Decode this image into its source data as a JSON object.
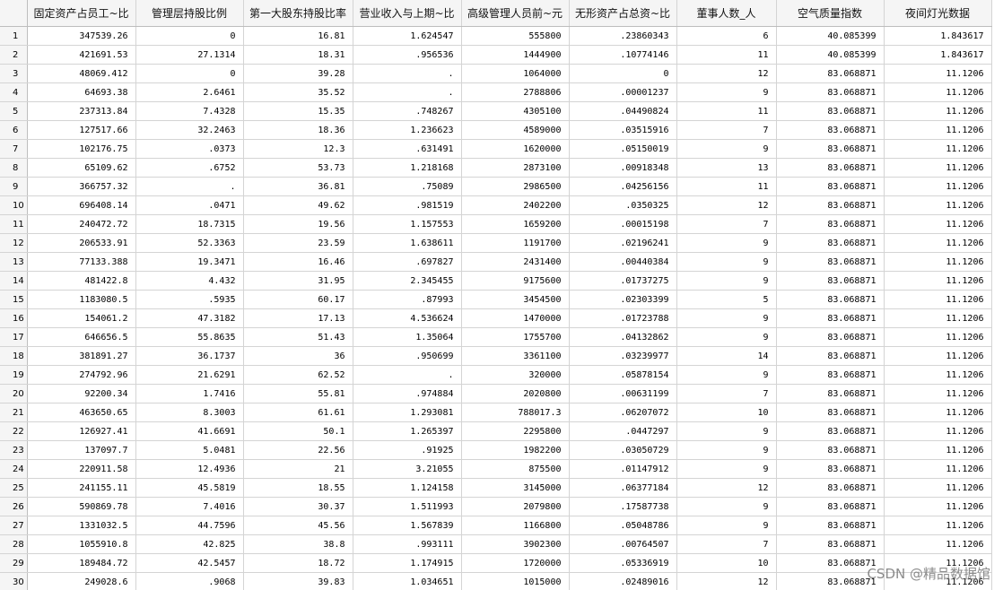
{
  "columns": [
    "固定资产占员工~比",
    "管理层持股比例",
    "第一大股东持股比率",
    "营业收入与上期~比",
    "高级管理人员前~元",
    "无形资产占总资~比",
    "董事人数_人",
    "空气质量指数",
    "夜间灯光数据"
  ],
  "rows": [
    [
      "1",
      "347539.26",
      "0",
      "16.81",
      "1.624547",
      "555800",
      ".23860343",
      "6",
      "40.085399",
      "1.843617"
    ],
    [
      "2",
      "421691.53",
      "27.1314",
      "18.31",
      ".956536",
      "1444900",
      ".10774146",
      "11",
      "40.085399",
      "1.843617"
    ],
    [
      "3",
      "48069.412",
      "0",
      "39.28",
      ".",
      "1064000",
      "0",
      "12",
      "83.068871",
      "11.1206"
    ],
    [
      "4",
      "64693.38",
      "2.6461",
      "35.52",
      ".",
      "2788806",
      ".00001237",
      "9",
      "83.068871",
      "11.1206"
    ],
    [
      "5",
      "237313.84",
      "7.4328",
      "15.35",
      ".748267",
      "4305100",
      ".04490824",
      "11",
      "83.068871",
      "11.1206"
    ],
    [
      "6",
      "127517.66",
      "32.2463",
      "18.36",
      "1.236623",
      "4589000",
      ".03515916",
      "7",
      "83.068871",
      "11.1206"
    ],
    [
      "7",
      "102176.75",
      ".0373",
      "12.3",
      ".631491",
      "1620000",
      ".05150019",
      "9",
      "83.068871",
      "11.1206"
    ],
    [
      "8",
      "65109.62",
      ".6752",
      "53.73",
      "1.218168",
      "2873100",
      ".00918348",
      "13",
      "83.068871",
      "11.1206"
    ],
    [
      "9",
      "366757.32",
      ".",
      "36.81",
      ".75089",
      "2986500",
      ".04256156",
      "11",
      "83.068871",
      "11.1206"
    ],
    [
      "10",
      "696408.14",
      ".0471",
      "49.62",
      ".981519",
      "2402200",
      ".0350325",
      "12",
      "83.068871",
      "11.1206"
    ],
    [
      "11",
      "240472.72",
      "18.7315",
      "19.56",
      "1.157553",
      "1659200",
      ".00015198",
      "7",
      "83.068871",
      "11.1206"
    ],
    [
      "12",
      "206533.91",
      "52.3363",
      "23.59",
      "1.638611",
      "1191700",
      ".02196241",
      "9",
      "83.068871",
      "11.1206"
    ],
    [
      "13",
      "77133.388",
      "19.3471",
      "16.46",
      ".697827",
      "2431400",
      ".00440384",
      "9",
      "83.068871",
      "11.1206"
    ],
    [
      "14",
      "481422.8",
      "4.432",
      "31.95",
      "2.345455",
      "9175600",
      ".01737275",
      "9",
      "83.068871",
      "11.1206"
    ],
    [
      "15",
      "1183080.5",
      ".5935",
      "60.17",
      ".87993",
      "3454500",
      ".02303399",
      "5",
      "83.068871",
      "11.1206"
    ],
    [
      "16",
      "154061.2",
      "47.3182",
      "17.13",
      "4.536624",
      "1470000",
      ".01723788",
      "9",
      "83.068871",
      "11.1206"
    ],
    [
      "17",
      "646656.5",
      "55.8635",
      "51.43",
      "1.35064",
      "1755700",
      ".04132862",
      "9",
      "83.068871",
      "11.1206"
    ],
    [
      "18",
      "381891.27",
      "36.1737",
      "36",
      ".950699",
      "3361100",
      ".03239977",
      "14",
      "83.068871",
      "11.1206"
    ],
    [
      "19",
      "274792.96",
      "21.6291",
      "62.52",
      ".",
      "320000",
      ".05878154",
      "9",
      "83.068871",
      "11.1206"
    ],
    [
      "20",
      "92200.34",
      "1.7416",
      "55.81",
      ".974884",
      "2020800",
      ".00631199",
      "7",
      "83.068871",
      "11.1206"
    ],
    [
      "21",
      "463650.65",
      "8.3003",
      "61.61",
      "1.293081",
      "788017.3",
      ".06207072",
      "10",
      "83.068871",
      "11.1206"
    ],
    [
      "22",
      "126927.41",
      "41.6691",
      "50.1",
      "1.265397",
      "2295800",
      ".0447297",
      "9",
      "83.068871",
      "11.1206"
    ],
    [
      "23",
      "137097.7",
      "5.0481",
      "22.56",
      ".91925",
      "1982200",
      ".03050729",
      "9",
      "83.068871",
      "11.1206"
    ],
    [
      "24",
      "220911.58",
      "12.4936",
      "21",
      "3.21055",
      "875500",
      ".01147912",
      "9",
      "83.068871",
      "11.1206"
    ],
    [
      "25",
      "241155.11",
      "45.5819",
      "18.55",
      "1.124158",
      "3145000",
      ".06377184",
      "12",
      "83.068871",
      "11.1206"
    ],
    [
      "26",
      "590869.78",
      "7.4016",
      "30.37",
      "1.511993",
      "2079800",
      ".17587738",
      "9",
      "83.068871",
      "11.1206"
    ],
    [
      "27",
      "1331032.5",
      "44.7596",
      "45.56",
      "1.567839",
      "1166800",
      ".05048786",
      "9",
      "83.068871",
      "11.1206"
    ],
    [
      "28",
      "1055910.8",
      "42.825",
      "38.8",
      ".993111",
      "3902300",
      ".00764507",
      "7",
      "83.068871",
      "11.1206"
    ],
    [
      "29",
      "189484.72",
      "42.5457",
      "18.72",
      "1.174915",
      "1720000",
      ".05336919",
      "10",
      "83.068871",
      "11.1206"
    ],
    [
      "30",
      "249028.6",
      ".9068",
      "39.83",
      "1.034651",
      "1015000",
      ".02489016",
      "12",
      "83.068871",
      "11.1206"
    ]
  ],
  "watermark": "CSDN @精品数据馆"
}
